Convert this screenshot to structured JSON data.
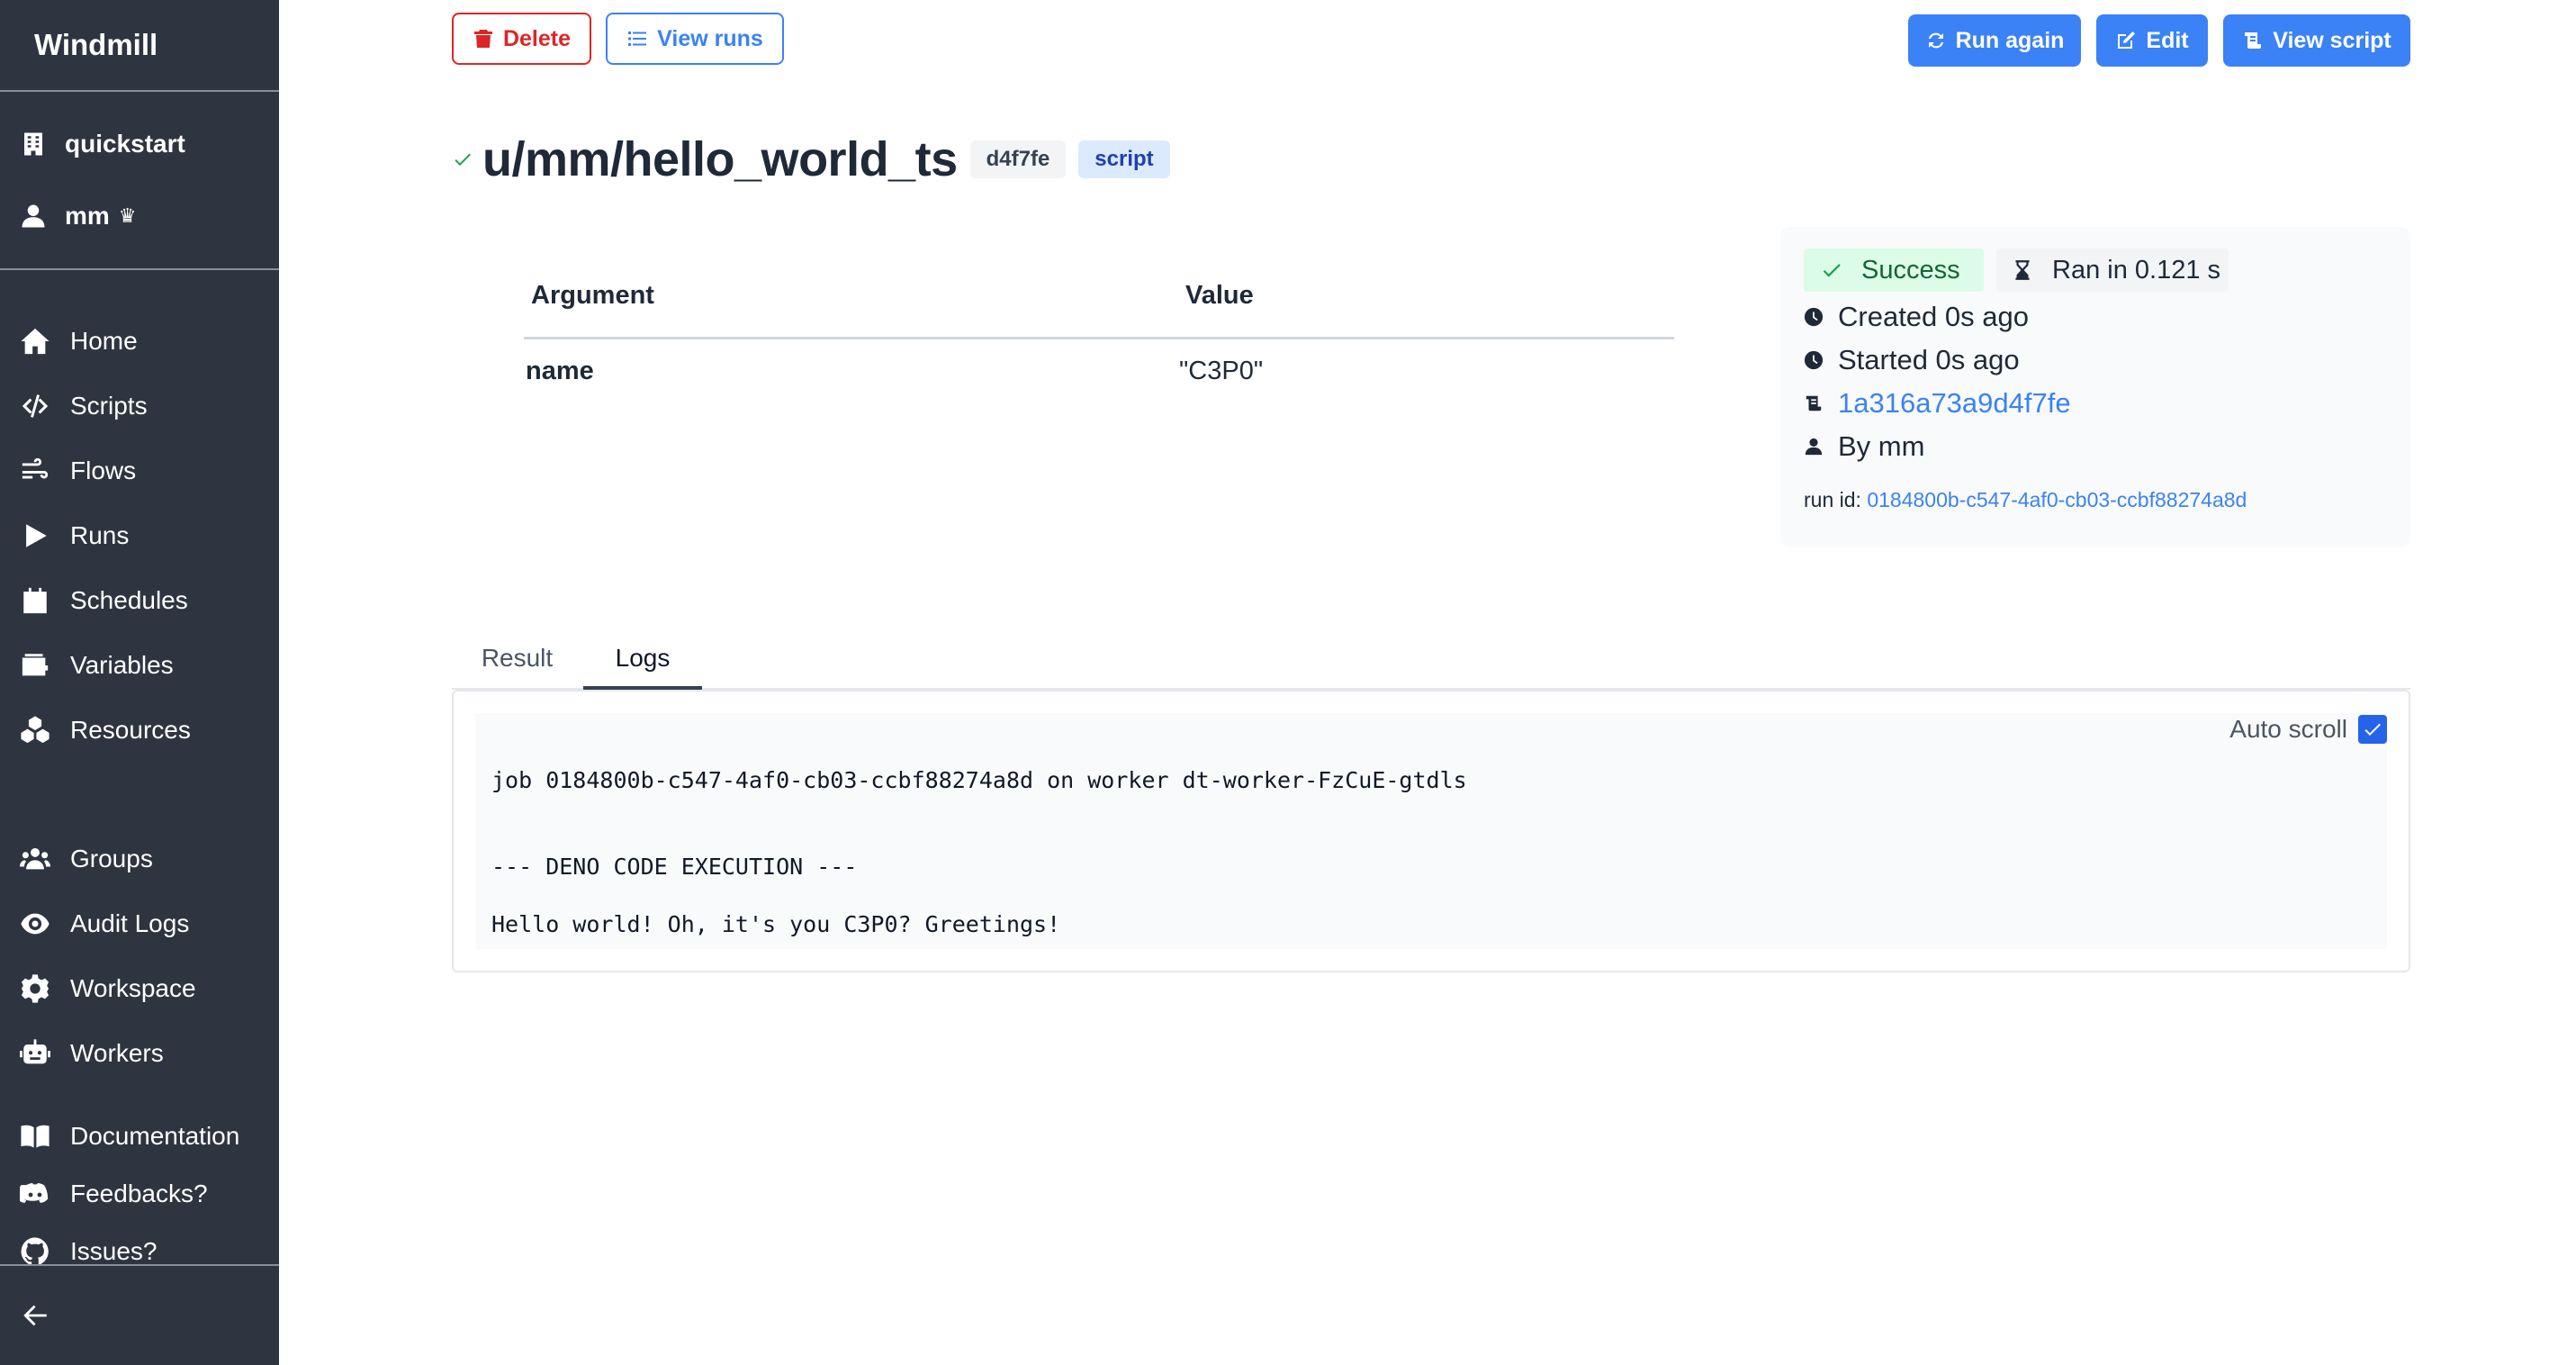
{
  "sidebar": {
    "brand": "Windmill",
    "workspace": "quickstart",
    "user": "mm",
    "user_badge": "♛",
    "nav": [
      {
        "label": "Home",
        "icon": "home-icon"
      },
      {
        "label": "Scripts",
        "icon": "code-icon"
      },
      {
        "label": "Flows",
        "icon": "wind-icon"
      },
      {
        "label": "Runs",
        "icon": "play-icon"
      },
      {
        "label": "Schedules",
        "icon": "calendar-icon"
      },
      {
        "label": "Variables",
        "icon": "wallet-icon"
      },
      {
        "label": "Resources",
        "icon": "cubes-icon"
      }
    ],
    "nav2": [
      {
        "label": "Groups",
        "icon": "users-icon"
      },
      {
        "label": "Audit Logs",
        "icon": "eye-icon"
      },
      {
        "label": "Workspace",
        "icon": "gear-icon"
      },
      {
        "label": "Workers",
        "icon": "robot-icon"
      }
    ],
    "nav3": [
      {
        "label": "Documentation",
        "icon": "book-icon"
      },
      {
        "label": "Feedbacks?",
        "icon": "discord-icon"
      },
      {
        "label": "Issues?",
        "icon": "github-icon"
      }
    ]
  },
  "toolbar": {
    "delete_label": "Delete",
    "view_runs_label": "View runs",
    "run_again_label": "Run again",
    "edit_label": "Edit",
    "view_script_label": "View script"
  },
  "job": {
    "path": "u/mm/hello_world_ts",
    "hash": "d4f7fe",
    "kind": "script"
  },
  "args_table": {
    "headers": [
      "Argument",
      "Value"
    ],
    "rows": [
      {
        "argument": "name",
        "value": "\"C3P0\""
      }
    ]
  },
  "status": {
    "success_label": "Success",
    "duration": "Ran in 0.121 s",
    "created": "Created 0s ago",
    "started": "Started 0s ago",
    "script_hash": "1a316a73a9d4f7fe",
    "by": "By mm",
    "run_id_label": "run id:",
    "run_id": "0184800b-c547-4af0-cb03-ccbf88274a8d"
  },
  "tabs": {
    "result": "Result",
    "logs": "Logs"
  },
  "logs": {
    "auto_scroll_label": "Auto scroll",
    "auto_scroll_checked": true,
    "lines": [
      "job 0184800b-c547-4af0-cb03-ccbf88274a8d on worker dt-worker-FzCuE-gtdls",
      "--- DENO CODE EXECUTION ---",
      "Hello world! Oh, it's you C3P0? Greetings!"
    ]
  },
  "colors": {
    "sidebar_bg": "#2e3440",
    "accent": "#3b82f6",
    "danger": "#dc2626",
    "success": "#16a34a"
  }
}
